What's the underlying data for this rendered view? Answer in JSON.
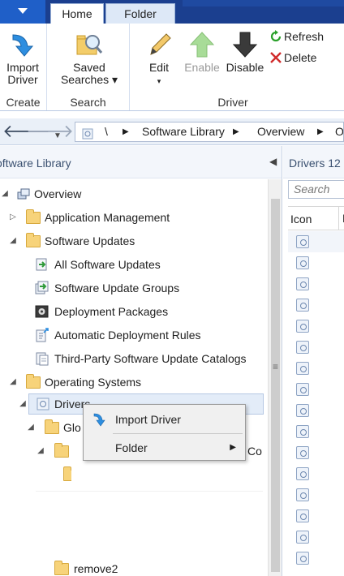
{
  "ribbon": {
    "tabs": {
      "home": "Home",
      "folder": "Folder"
    },
    "groups": {
      "create": {
        "label": "Create",
        "import_driver": {
          "line1": "Import",
          "line2": "Driver"
        }
      },
      "search": {
        "label": "Search",
        "saved_searches": {
          "line1": "Saved",
          "line2": "Searches ▾"
        }
      },
      "driver": {
        "label": "Driver",
        "edit": {
          "line1": "Edit",
          "line2": "▾"
        },
        "enable": "Enable",
        "disable": "Disable",
        "refresh": "Refresh",
        "delete": "Delete"
      }
    }
  },
  "address": {
    "root": "\\",
    "crumb1": "Software Library",
    "crumb2": "Overview",
    "crumb3": "O"
  },
  "left": {
    "title": "oftware Library",
    "tree": {
      "overview": "Overview",
      "app_mgmt": "Application Management",
      "sw_updates": "Software Updates",
      "all_sw_updates": "All Software Updates",
      "sw_update_groups": "Software Update Groups",
      "deploy_pkgs": "Deployment Packages",
      "adr": "Automatic Deployment Rules",
      "third_party": "Third-Party Software Update Catalogs",
      "os": "Operating Systems",
      "drivers": "Drivers",
      "glo": "Glo",
      "co": "Co",
      "remove2": "remove2"
    }
  },
  "right": {
    "title": "Drivers 12",
    "search_placeholder": "Search",
    "col_icon": "Icon",
    "col_next": "N"
  },
  "context_menu": {
    "import_driver": "Import Driver",
    "folder": "Folder",
    "submenu_arrow": "▶"
  },
  "colors": {
    "ribbon_tab_bar": "#1b3f8f",
    "selection": "#e3ecf8",
    "folder": "#f7d37a"
  }
}
